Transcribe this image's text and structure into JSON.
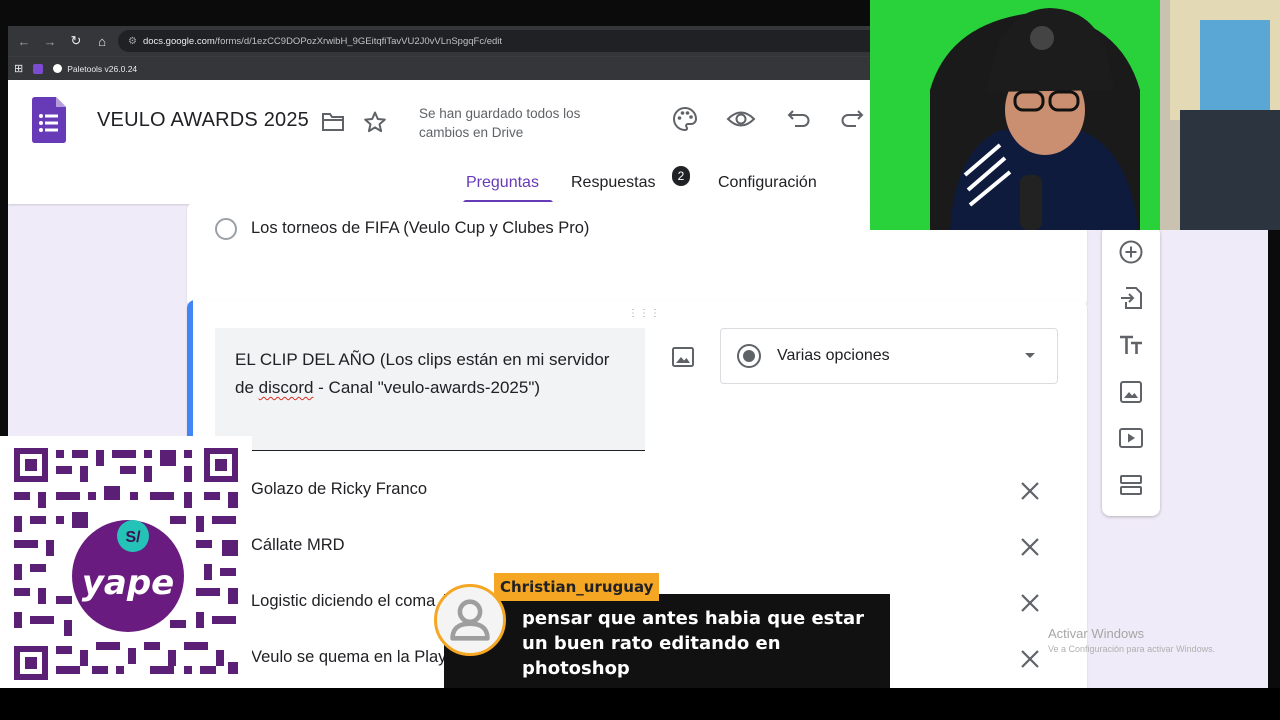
{
  "browser": {
    "url_host": "docs.google.com",
    "url_path": "/forms/d/1ezCC9DOPozXrwibH_9GEitqfiTavVU2J0vVLnSpgqFc/edit",
    "bookmark_label": "Paletools v26.0.24"
  },
  "form": {
    "title": "VEULO AWARDS 2025",
    "save_status": "Se han guardado todos los cambios en Drive",
    "tabs": [
      {
        "label": "Preguntas"
      },
      {
        "label": "Respuestas"
      },
      {
        "label": "Configuración"
      }
    ],
    "responses_count": "2",
    "accent_color": "#673ab7"
  },
  "prev_question": {
    "option": "Los torneos de FIFA (Veulo Cup y Clubes Pro)"
  },
  "active_question": {
    "title_part1": "EL CLIP DEL AÑO (Los clips están en mi servidor de ",
    "title_misspelled": "discord",
    "title_part2": " - Canal \"veulo-awards-2025\")",
    "type_label": "Varias opciones",
    "options": [
      "Golazo de Ricky Franco",
      "Cállate MRD",
      "Logistic diciendo el coma",
      "Veulo se quema en la Play"
    ]
  },
  "sidebar_icons": [
    "add-question-icon",
    "import-questions-icon",
    "title-text-icon",
    "add-image-icon",
    "add-video-icon",
    "add-section-icon"
  ],
  "watermark": {
    "line1": "Activar Windows",
    "line2": "Ve a Configuración para activar Windows."
  },
  "qr": {
    "badge": "S/",
    "brand": "yape"
  },
  "chat": {
    "username": "Christian_uruguay",
    "message": "pensar que antes habia que estar un buen rato editando en photoshop"
  }
}
